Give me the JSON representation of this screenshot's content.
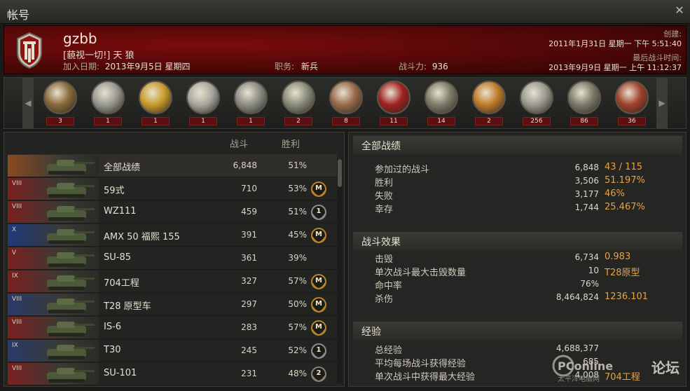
{
  "window": {
    "title": "帐号"
  },
  "player": {
    "name": "gzbb",
    "clan": "[藐视一切!] 天 狼",
    "joined_label": "加入日期:",
    "joined_value": "2013年9月5日 星期四",
    "role_label": "职务:",
    "role_value": "新兵",
    "power_label": "战斗力:",
    "power_value": "936",
    "created_label": "创建:",
    "created_value": "2011年1月31日 星期一 下午 5:51:40",
    "last_battle_label": "最后战斗时间:",
    "last_battle_value": "2013年9月9日 星期一 上午 11:12:37"
  },
  "medals": [
    {
      "icon": "sword-shield-medal-icon",
      "count": "3",
      "color": "#8a6a3a"
    },
    {
      "icon": "tank-laurel-medal-icon",
      "count": "1",
      "color": "#9a9a92"
    },
    {
      "icon": "gold-tank-star-medal-icon",
      "count": "1",
      "color": "#c99a2a"
    },
    {
      "icon": "silver-tank-medal-icon",
      "count": "1",
      "color": "#a8a8a0"
    },
    {
      "icon": "tank-guns-medal-icon",
      "count": "1",
      "color": "#8d8d86"
    },
    {
      "icon": "tank-badge-medal-icon",
      "count": "2",
      "color": "#8a8c7a"
    },
    {
      "icon": "tiger-tank-medal-icon",
      "count": "8",
      "color": "#9a6a4a"
    },
    {
      "icon": "red-shield-medal-icon",
      "count": "11",
      "color": "#a02020"
    },
    {
      "icon": "tank-wreath-medal-icon",
      "count": "14",
      "color": "#7d7d6a"
    },
    {
      "icon": "sun-tank-medal-icon",
      "count": "2",
      "color": "#c07a28"
    },
    {
      "icon": "target-tank-medal-icon",
      "count": "256",
      "color": "#9a9a90"
    },
    {
      "icon": "shield-tank-medal-icon",
      "count": "86",
      "color": "#7d7a6a"
    },
    {
      "icon": "flame-tank-medal-icon",
      "count": "36",
      "color": "#a0402a"
    }
  ],
  "vehicles": {
    "col_battles": "战斗",
    "col_wins": "胜利",
    "rows": [
      {
        "tier": "",
        "name": "全部战绩",
        "battles": "6,848",
        "wins": "51%",
        "mark": "",
        "flag": "#8a4a22"
      },
      {
        "tier": "VIII",
        "name": "59式",
        "battles": "710",
        "wins": "53%",
        "mark": "M",
        "flag": "#7a2020"
      },
      {
        "tier": "VIII",
        "name": "WZ111",
        "battles": "459",
        "wins": "51%",
        "mark": "1",
        "flag": "#7a2020"
      },
      {
        "tier": "X",
        "name": "AMX 50 福熙 155",
        "battles": "391",
        "wins": "45%",
        "mark": "M",
        "flag": "#1e3a7a"
      },
      {
        "tier": "V",
        "name": "SU-85",
        "battles": "361",
        "wins": "39%",
        "mark": "",
        "flag": "#7a2020"
      },
      {
        "tier": "IX",
        "name": "704工程",
        "battles": "327",
        "wins": "57%",
        "mark": "M",
        "flag": "#7a2020"
      },
      {
        "tier": "VIII",
        "name": "T28 原型车",
        "battles": "297",
        "wins": "50%",
        "mark": "M",
        "flag": "#2a3a6a"
      },
      {
        "tier": "VIII",
        "name": "IS-6",
        "battles": "283",
        "wins": "57%",
        "mark": "M",
        "flag": "#7a2020"
      },
      {
        "tier": "IX",
        "name": "T30",
        "battles": "245",
        "wins": "52%",
        "mark": "1",
        "flag": "#2a3a6a"
      },
      {
        "tier": "VIII",
        "name": "SU-101",
        "battles": "231",
        "wins": "48%",
        "mark": "2",
        "flag": "#7a2020"
      }
    ]
  },
  "stats": {
    "overall": {
      "title": "全部战绩",
      "rows": [
        {
          "label": "参加过的战斗",
          "value": "6,848",
          "extra": "43 / 115"
        },
        {
          "label": "胜利",
          "value": "3,506",
          "extra": "51.197%"
        },
        {
          "label": "失败",
          "value": "3,177",
          "extra": "46%"
        },
        {
          "label": "幸存",
          "value": "1,744",
          "extra": "25.467%"
        }
      ]
    },
    "efficiency": {
      "title": "战斗效果",
      "rows": [
        {
          "label": "击毁",
          "value": "6,734",
          "extra": "0.983"
        },
        {
          "label": "单次战斗最大击毁数量",
          "value": "10",
          "extra": "T28原型"
        },
        {
          "label": "命中率",
          "value": "76%",
          "extra": ""
        },
        {
          "label": "杀伤",
          "value": "8,464,824",
          "extra": "1236.101"
        }
      ]
    },
    "experience": {
      "title": "经验",
      "rows": [
        {
          "label": "总经验",
          "value": "4,688,377",
          "extra": ""
        },
        {
          "label": "平均每场战斗获得经验",
          "value": "685",
          "extra": ""
        },
        {
          "label": "单次战斗中获得最大经验",
          "value": "4,008",
          "extra": "704工程"
        }
      ]
    }
  },
  "watermark": {
    "brand": "PConline",
    "sub": "太平洋电脑网",
    "forum": "论坛"
  }
}
